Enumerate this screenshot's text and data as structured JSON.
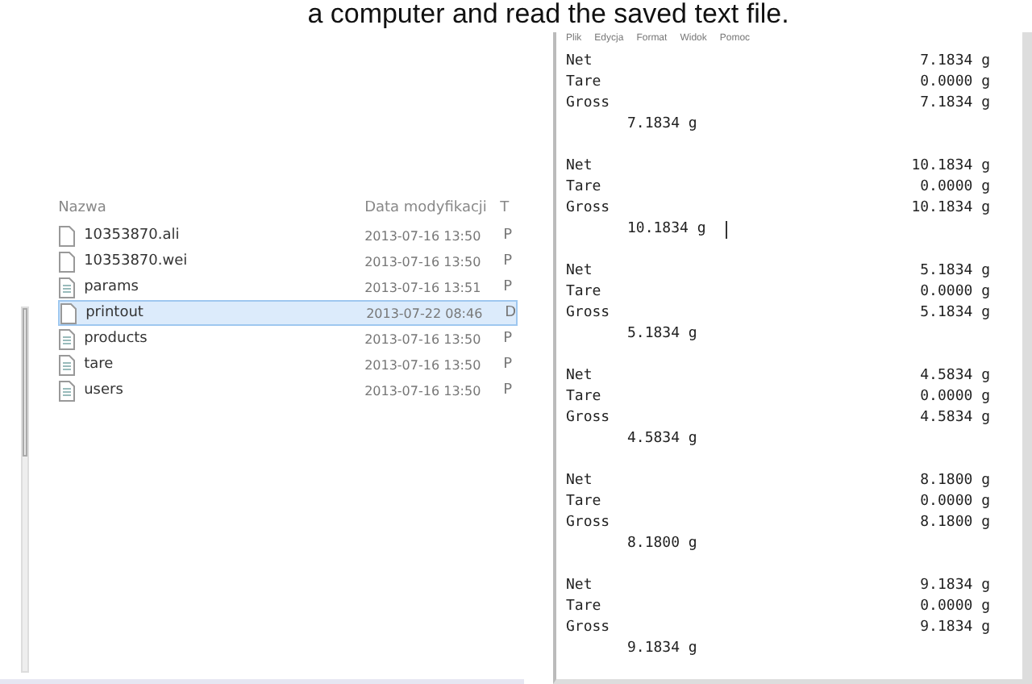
{
  "caption": "a computer and read the saved text file.",
  "explorer": {
    "columns": [
      "Nazwa",
      "Data modyfikacji",
      "T"
    ],
    "files": [
      {
        "name": "10353870.ali",
        "date": "2013-07-16 13:50",
        "type": "P",
        "kind": "blank",
        "selected": false
      },
      {
        "name": "10353870.wei",
        "date": "2013-07-16 13:50",
        "type": "P",
        "kind": "blank",
        "selected": false
      },
      {
        "name": "params",
        "date": "2013-07-16 13:51",
        "type": "P",
        "kind": "text",
        "selected": false
      },
      {
        "name": "printout",
        "date": "2013-07-22 08:46",
        "type": "D",
        "kind": "blank",
        "selected": true
      },
      {
        "name": "products",
        "date": "2013-07-16 13:50",
        "type": "P",
        "kind": "text",
        "selected": false
      },
      {
        "name": "tare",
        "date": "2013-07-16 13:50",
        "type": "P",
        "kind": "text",
        "selected": false
      },
      {
        "name": "users",
        "date": "2013-07-16 13:50",
        "type": "P",
        "kind": "text",
        "selected": false
      }
    ]
  },
  "notepad": {
    "menu": [
      "Plik",
      "Edycja",
      "Format",
      "Widok",
      "Pomoc"
    ],
    "records": [
      {
        "lines": [
          {
            "label": "Net",
            "value": "7.1834 g"
          },
          {
            "label": "Tare",
            "value": "0.0000 g"
          },
          {
            "label": "Gross",
            "value": "7.1834 g"
          }
        ],
        "result": "7.1834 g",
        "cursor": false
      },
      {
        "lines": [
          {
            "label": "Net",
            "value": "10.1834 g"
          },
          {
            "label": "Tare",
            "value": "0.0000 g"
          },
          {
            "label": "Gross",
            "value": "10.1834 g"
          }
        ],
        "result": "10.1834 g",
        "cursor": true
      },
      {
        "lines": [
          {
            "label": "Net",
            "value": "5.1834 g"
          },
          {
            "label": "Tare",
            "value": "0.0000 g"
          },
          {
            "label": "Gross",
            "value": "5.1834 g"
          }
        ],
        "result": "5.1834 g",
        "cursor": false
      },
      {
        "lines": [
          {
            "label": "Net",
            "value": "4.5834 g"
          },
          {
            "label": "Tare",
            "value": "0.0000 g"
          },
          {
            "label": "Gross",
            "value": "4.5834 g"
          }
        ],
        "result": "4.5834 g",
        "cursor": false
      },
      {
        "lines": [
          {
            "label": "Net",
            "value": "8.1800 g"
          },
          {
            "label": "Tare",
            "value": "0.0000 g"
          },
          {
            "label": "Gross",
            "value": "8.1800 g"
          }
        ],
        "result": "8.1800 g",
        "cursor": false
      },
      {
        "lines": [
          {
            "label": "Net",
            "value": "9.1834 g"
          },
          {
            "label": "Tare",
            "value": "0.0000 g"
          },
          {
            "label": "Gross",
            "value": "9.1834 g"
          }
        ],
        "result": "9.1834 g",
        "cursor": false
      }
    ]
  }
}
